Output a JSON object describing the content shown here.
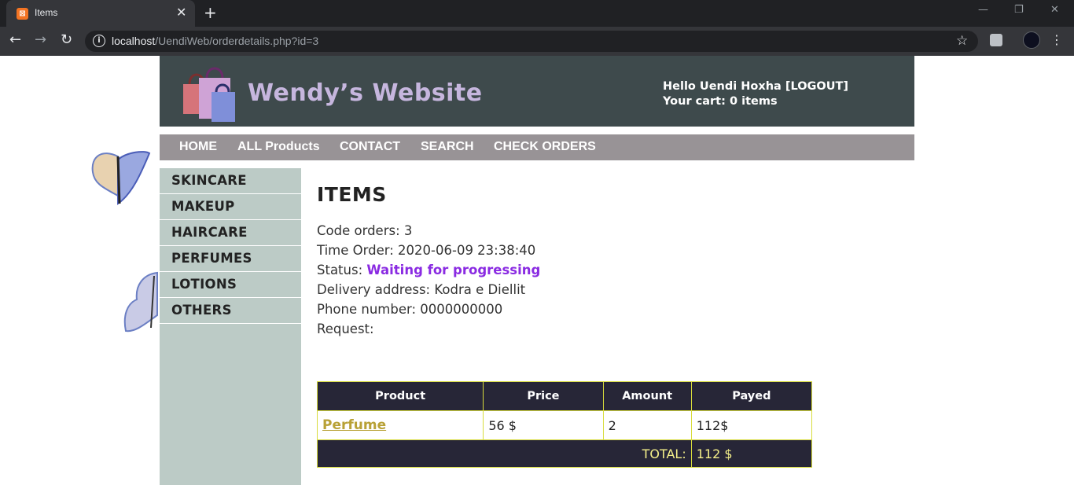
{
  "browser": {
    "tab_title": "Items",
    "favicon_glyph": "⊠",
    "tab_close_glyph": "✕",
    "new_tab_glyph": "+",
    "url_host": "localhost",
    "url_path": "/UendiWeb/orderdetails.php?id=3",
    "icons": {
      "back": "back-arrow-icon",
      "forward": "forward-arrow-icon",
      "reload": "reload-icon",
      "info": "info-icon",
      "star": "bookmark-star-icon",
      "extension": "extension-icon",
      "profile": "profile-icon",
      "menu": "kebab-menu-icon"
    },
    "glyphs": {
      "back": "←",
      "forward": "→",
      "reload": "↻",
      "info": "i",
      "star": "☆",
      "menu": "⋮",
      "minimize": "—",
      "restore": "❐",
      "close": "✕"
    }
  },
  "header": {
    "site_name": "Wendy’s Website",
    "greeting": "Hello Uendi Hoxha [LOGOUT]",
    "cart": "Your cart: 0 items"
  },
  "nav": {
    "items": [
      "HOME",
      "ALL Products",
      "CONTACT",
      "SEARCH",
      "CHECK ORDERS"
    ]
  },
  "sidebar": {
    "categories": [
      "SKINCARE",
      "MAKEUP",
      "HAIRCARE",
      "PERFUMES",
      "LOTIONS",
      "OTHERS"
    ]
  },
  "order": {
    "heading": "ITEMS",
    "code_label": "Code orders:",
    "code_value": "3",
    "time_label": "Time Order:",
    "time_value": "2020-06-09 23:38:40",
    "status_label": "Status:",
    "status_value": "Waiting for progressing",
    "address_label": "Delivery address:",
    "address_value": "Kodra e Diellit",
    "phone_label": "Phone number:",
    "phone_value": "0000000000",
    "request_label": "Request:"
  },
  "table": {
    "headers": [
      "Product",
      "Price",
      "Amount",
      "Payed"
    ],
    "rows": [
      {
        "product": "Perfume",
        "price": "56 $",
        "amount": "2",
        "payed": "112$"
      }
    ],
    "total_label": "TOTAL:",
    "total_value": "112 $"
  },
  "colors": {
    "header_bg": "#3e4a4c",
    "nav_bg": "#989396",
    "sidebar_bg": "#bccbc6",
    "table_header_bg": "#272637",
    "table_border": "#d8dc3c",
    "status_color": "#8a2be2",
    "link_color": "#b8a136",
    "total_color": "#f5f08a",
    "site_name_color": "#c6b6de"
  }
}
